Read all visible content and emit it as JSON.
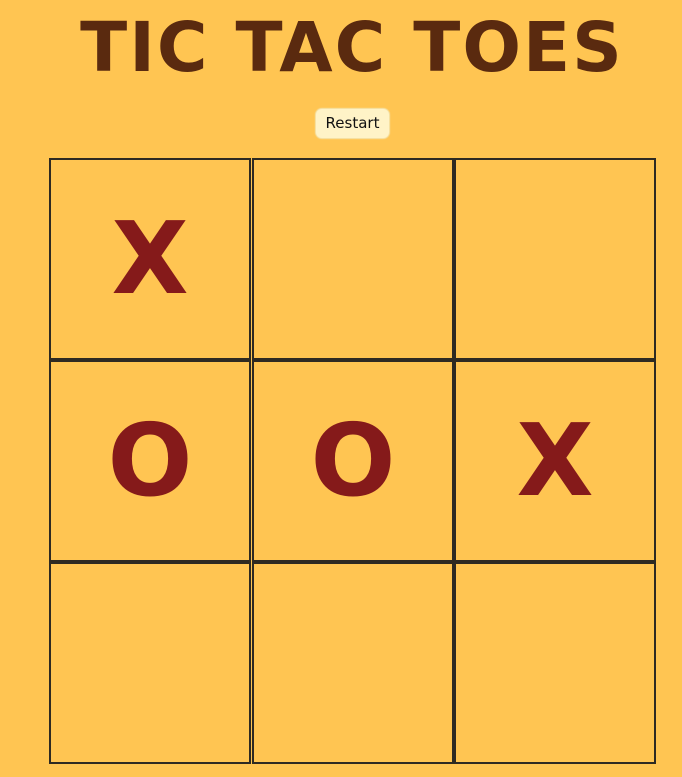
{
  "title": "TIC TAC TOES",
  "restart_label": "Restart",
  "colors": {
    "background": "#ffc552",
    "title": "#5a2a0f",
    "mark": "#851a1a",
    "grid_line": "#2e2a22",
    "button_bg": "#fff3c7"
  },
  "board": {
    "cells": [
      "X",
      "",
      "",
      "O",
      "O",
      "X",
      "",
      "",
      ""
    ]
  }
}
